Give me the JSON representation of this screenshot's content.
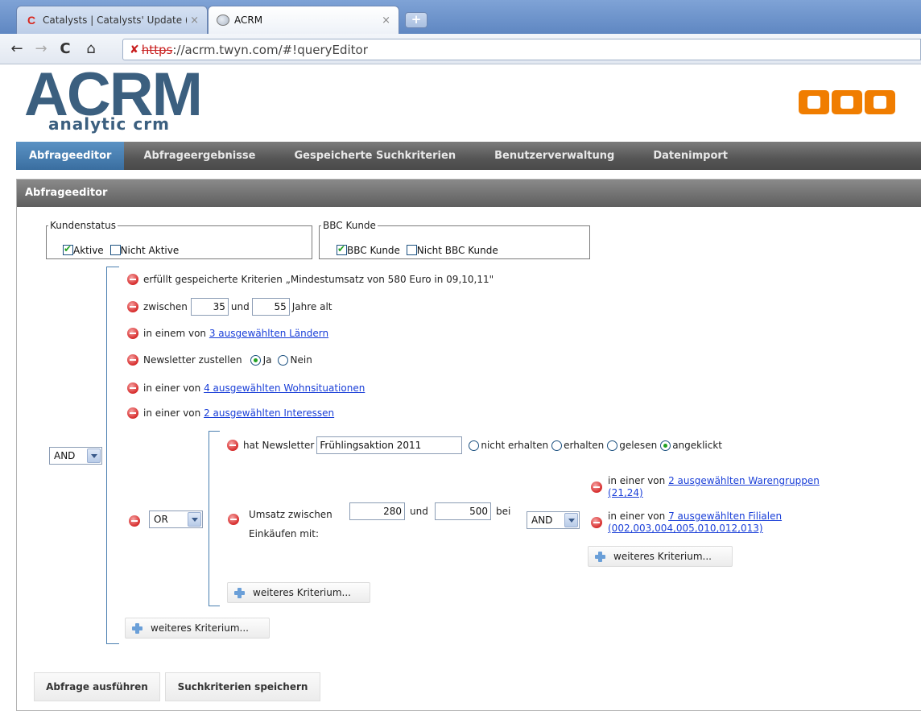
{
  "browser": {
    "tabs": [
      {
        "title": "Catalysts | Catalysts' Update (",
        "active": false,
        "icon": "catalysts-favicon"
      },
      {
        "title": "ACRM",
        "active": true,
        "icon": "globe-favicon"
      }
    ],
    "new_tab_label": "+",
    "url": {
      "scheme": "https",
      "rest": "://acrm.twyn.com/#!queryEditor"
    }
  },
  "header": {
    "logo_title": "ACRM",
    "logo_subtitle": "analytic crm",
    "brand_logo": "OBI",
    "brand_color": "#f07d00",
    "logo_color": "#3b5f7f"
  },
  "nav": {
    "items": [
      {
        "label": "Abfrageeditor",
        "active": true
      },
      {
        "label": "Abfrageergebnisse",
        "active": false
      },
      {
        "label": "Gespeicherte Suchkriterien",
        "active": false
      },
      {
        "label": "Benutzerverwaltung",
        "active": false
      },
      {
        "label": "Datenimport",
        "active": false
      }
    ],
    "active_color": "#3a6ea0"
  },
  "panel": {
    "title": "Abfrageeditor",
    "kundenstatus": {
      "legend": "Kundenstatus",
      "options": [
        {
          "label": "Aktive",
          "checked": true
        },
        {
          "label": "Nicht Aktive",
          "checked": false
        }
      ]
    },
    "bbc": {
      "legend": "BBC Kunde",
      "options": [
        {
          "label": "BBC Kunde",
          "checked": true
        },
        {
          "label": "Nicht BBC Kunde",
          "checked": false
        }
      ]
    },
    "root_operator": "AND",
    "criteria": {
      "saved": "erfüllt gespeicherte Kriterien „Mindestumsatz von 580 Euro in 09,10,11\"",
      "age": {
        "prefix": "zwischen",
        "from": "35",
        "middle": "und",
        "to": "55",
        "suffix": "Jahre alt"
      },
      "countries": {
        "prefix": "in einem von",
        "link": "3 ausgewählten Ländern"
      },
      "newsletter": {
        "label": "Newsletter zustellen",
        "options": [
          {
            "label": "Ja",
            "checked": true
          },
          {
            "label": "Nein",
            "checked": false
          }
        ]
      },
      "housing": {
        "prefix": "in einer von",
        "link": "4 ausgewählten Wohnsituationen"
      },
      "interests": {
        "prefix": "in einer von",
        "link": "2 ausgewählten Interessen"
      }
    },
    "or_group": {
      "operator": "OR",
      "newsletter": {
        "label": "hat Newsletter",
        "value": "Frühlingsaktion 2011",
        "options": [
          {
            "label": "nicht erhalten",
            "checked": false
          },
          {
            "label": "erhalten",
            "checked": false
          },
          {
            "label": "gelesen",
            "checked": false
          },
          {
            "label": "angeklickt",
            "checked": true
          }
        ]
      },
      "revenue": {
        "line1": "Umsatz zwischen",
        "line2": "Einkäufen mit:",
        "from": "280",
        "middle": "und",
        "to": "500",
        "suffix": "bei",
        "operator": "AND",
        "sub": [
          {
            "prefix": "in einer von",
            "link_line1": "2 ausgewählten Warengruppen",
            "link_line2": "(21,24)"
          },
          {
            "prefix": "in einer von",
            "link_line1": "7 ausgewählten Filialen",
            "link_line2": "(002,003,004,005,010,012,013)"
          }
        ],
        "add_label": "weiteres Kriterium..."
      },
      "add_label": "weiteres Kriterium..."
    },
    "add_label": "weiteres Kriterium...",
    "buttons": {
      "run": "Abfrage ausführen",
      "save": "Suchkriterien speichern"
    }
  }
}
